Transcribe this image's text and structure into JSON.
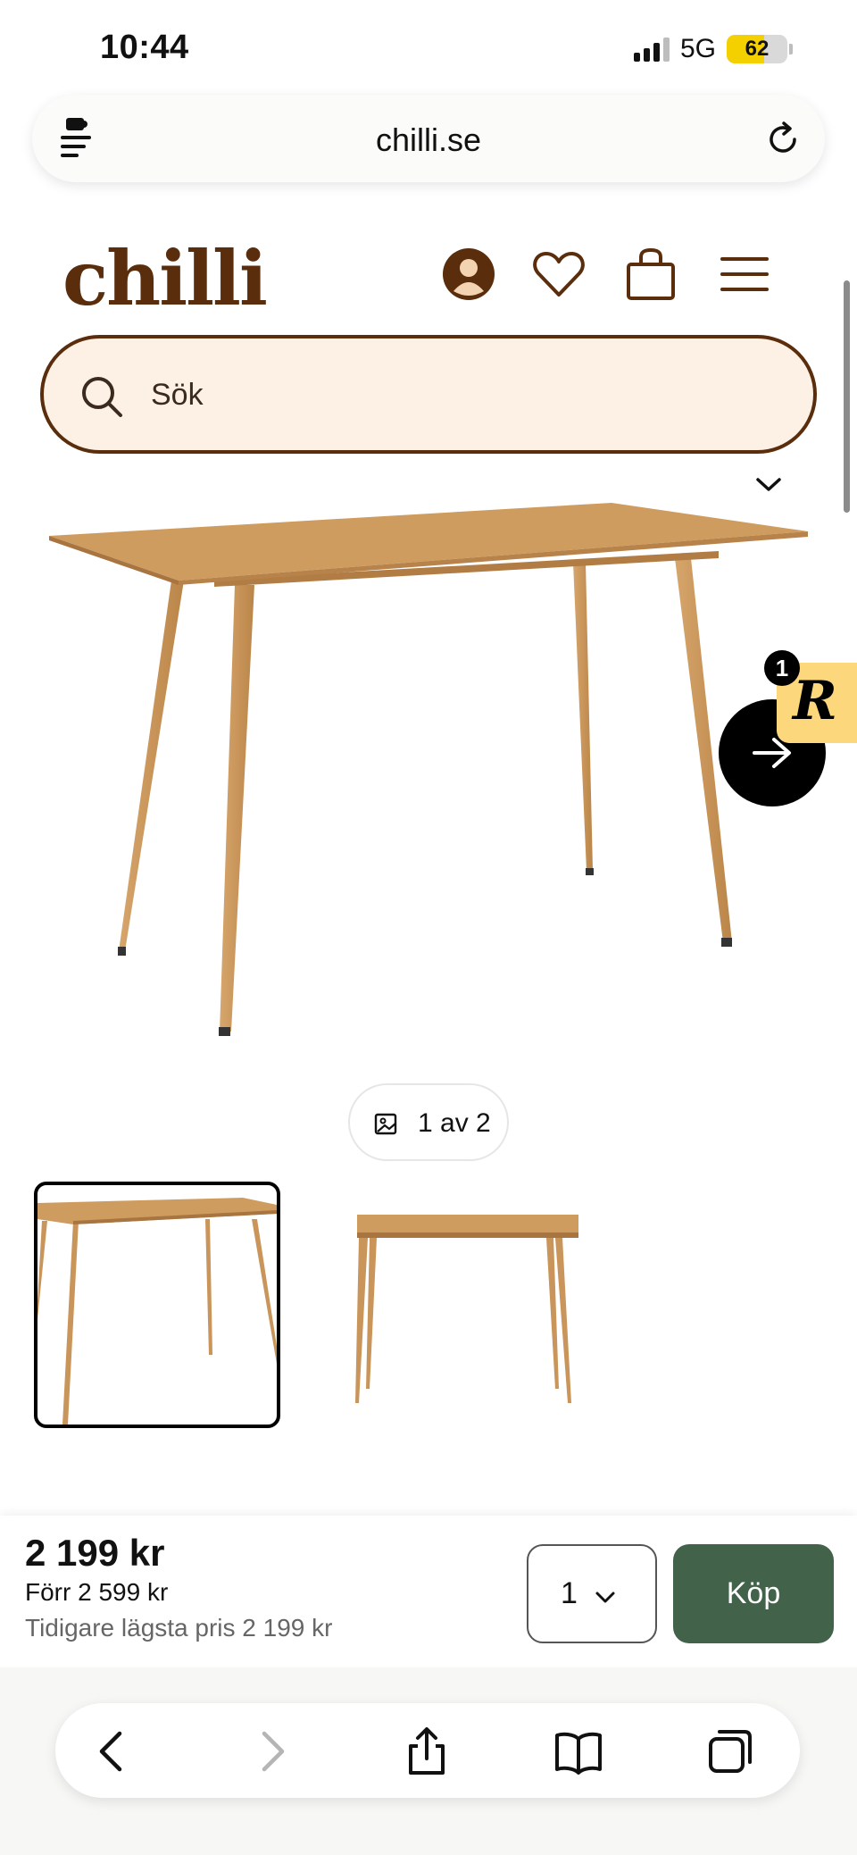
{
  "status_bar": {
    "time": "10:44",
    "network": "5G",
    "battery": "62",
    "battery_level": 0.62
  },
  "browser": {
    "url": "chilli.se",
    "left_icon": "extensions-icon",
    "right_icon": "reload-icon"
  },
  "site": {
    "logo": "chilli",
    "header_icons": [
      "account-icon",
      "heart-icon",
      "bag-icon",
      "menu-icon"
    ]
  },
  "search": {
    "placeholder": "Sök"
  },
  "gallery": {
    "counter": "1 av 2",
    "thumbnails": 2,
    "active_index": 0
  },
  "floating": {
    "badge_letter": "R",
    "badge_count": "1"
  },
  "buy": {
    "price": "2 199 kr",
    "before": "Förr 2 599 kr",
    "lowest": "Tidigare lägsta pris 2 199 kr",
    "quantity": "1",
    "button": "Köp"
  },
  "toolbar": {
    "items": [
      "back-icon",
      "forward-icon",
      "share-icon",
      "bookmarks-icon",
      "tabs-icon"
    ]
  },
  "colors": {
    "brand_brown": "#5a2d0c",
    "search_bg": "#fdf1e6",
    "buy_green": "#42634a",
    "wood": "#c9955a"
  }
}
